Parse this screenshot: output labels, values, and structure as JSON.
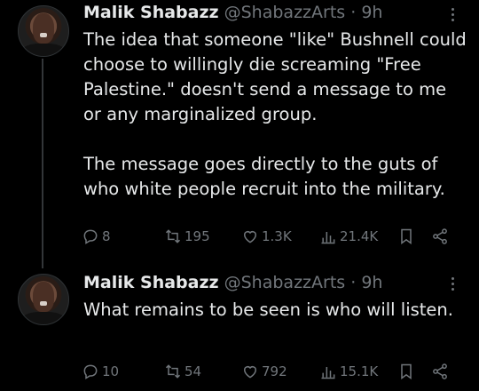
{
  "tweets": [
    {
      "author_name": "Malik Shabazz",
      "handle": "@ShabazzArts",
      "separator": "·",
      "time": "9h",
      "paragraphs": [
        "The idea that someone \"like\" Bushnell could choose to willingly die screaming \"Free Palestine.\" doesn't send a message to me or any marginalized group.",
        "The message goes directly to the guts of who white people recruit into the military."
      ],
      "replies": "8",
      "retweets": "195",
      "likes": "1.3K",
      "views": "21.4K"
    },
    {
      "author_name": "Malik Shabazz",
      "handle": "@ShabazzArts",
      "separator": "·",
      "time": "9h",
      "paragraphs": [
        "What remains to be seen is who will listen."
      ],
      "replies": "10",
      "retweets": "54",
      "likes": "792",
      "views": "15.1K"
    }
  ],
  "icons": {
    "reply": "reply-icon",
    "retweet": "retweet-icon",
    "like": "heart-icon",
    "views": "views-icon",
    "bookmark": "bookmark-icon",
    "share": "share-icon",
    "more": "more-icon"
  },
  "colors": {
    "background": "#000000",
    "text": "#e7e9ea",
    "muted": "#71767b"
  }
}
